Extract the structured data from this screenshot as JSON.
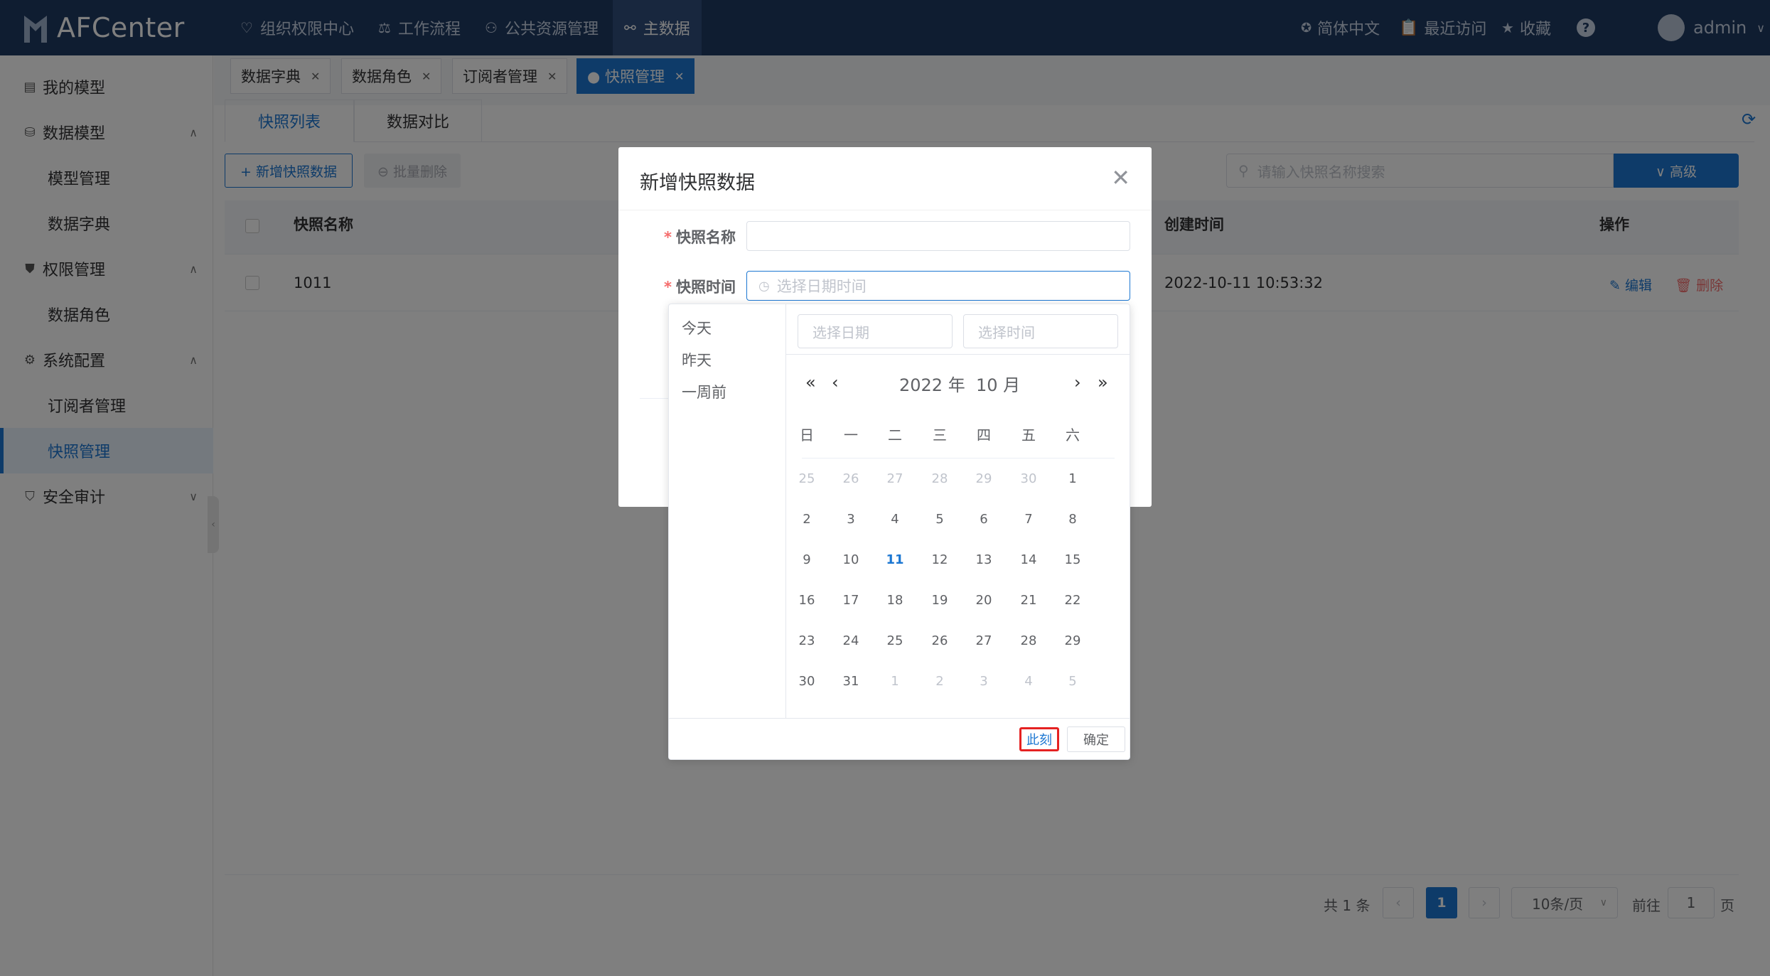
{
  "app": {
    "logo_text": "AFCenter"
  },
  "nav": [
    {
      "label": "组织权限中心",
      "icon": "shield-heart-icon"
    },
    {
      "label": "工作流程",
      "icon": "scale-icon"
    },
    {
      "label": "公共资源管理",
      "icon": "users-icon"
    },
    {
      "label": "主数据",
      "icon": "link-icon"
    }
  ],
  "topright": {
    "lang": "简体中文",
    "recent": "最近访问",
    "favorite": "收藏",
    "help": "?",
    "user": "admin"
  },
  "sidebar": {
    "my_model": "我的模型",
    "data_model": "数据模型",
    "model_mgmt": "模型管理",
    "data_dict": "数据字典",
    "perm_mgmt": "权限管理",
    "data_role": "数据角色",
    "sys_config": "系统配置",
    "subscriber_mgmt": "订阅者管理",
    "snapshot_mgmt": "快照管理",
    "security_audit": "安全审计"
  },
  "tabs": [
    {
      "label": "数据字典"
    },
    {
      "label": "数据角色"
    },
    {
      "label": "订阅者管理"
    },
    {
      "label": "● 快照管理"
    }
  ],
  "subtabs": {
    "list": "快照列表",
    "compare": "数据对比"
  },
  "toolbar": {
    "add": "+ 新增快照数据",
    "batch_delete": "⊖ 批量删除",
    "search_placeholder": "请输入快照名称搜索",
    "advanced": "∨ 高级"
  },
  "table": {
    "headers": {
      "name": "快照名称",
      "created": "创建时间",
      "ops": "操作"
    },
    "rows": [
      {
        "name": "1011",
        "created": "2022-10-11 10:53:32",
        "edit": "编辑",
        "delete": "删除"
      }
    ]
  },
  "pagination": {
    "total": "共 1 条",
    "page": "1",
    "page_size": "10条/页",
    "goto": "前往",
    "goto_value": "1",
    "page_unit": "页"
  },
  "dialog": {
    "title": "新增快照数据",
    "name_label": "快照名称",
    "time_label": "快照时间",
    "time_placeholder": "选择日期时间"
  },
  "picker": {
    "shortcuts": [
      "今天",
      "昨天",
      "一周前"
    ],
    "date_placeholder": "选择日期",
    "time_placeholder": "选择时间",
    "header": "2022 年  10 月",
    "weekdays": [
      "日",
      "一",
      "二",
      "三",
      "四",
      "五",
      "六"
    ],
    "weeks": [
      [
        "25",
        "26",
        "27",
        "28",
        "29",
        "30",
        "1"
      ],
      [
        "2",
        "3",
        "4",
        "5",
        "6",
        "7",
        "8"
      ],
      [
        "9",
        "10",
        "11",
        "12",
        "13",
        "14",
        "15"
      ],
      [
        "16",
        "17",
        "18",
        "19",
        "20",
        "21",
        "22"
      ],
      [
        "23",
        "24",
        "25",
        "26",
        "27",
        "28",
        "29"
      ],
      [
        "30",
        "31",
        "1",
        "2",
        "3",
        "4",
        "5"
      ]
    ],
    "today": "11",
    "now_button": "此刻",
    "ok_button": "确定"
  },
  "colors": {
    "primary": "#1c77d2",
    "topbar": "#1f3a63",
    "danger": "#f56c6c"
  }
}
